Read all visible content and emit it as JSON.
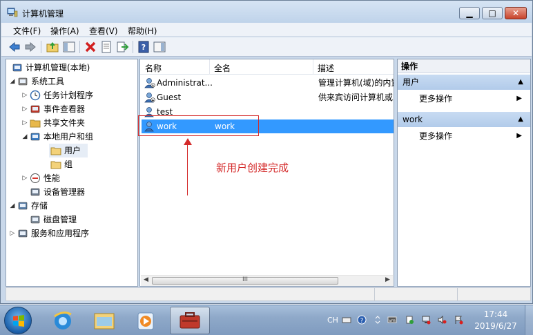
{
  "window": {
    "title": "计算机管理",
    "min_glyph": "▁",
    "max_glyph": "□",
    "close_glyph": "✕"
  },
  "menu": [
    "文件(F)",
    "操作(A)",
    "查看(V)",
    "帮助(H)"
  ],
  "toolbar_icons": [
    "back-arrow-icon",
    "forward-arrow-icon",
    "up-folder-icon",
    "show-hide-tree-icon",
    "delete-icon",
    "properties-icon",
    "export-icon",
    "help-icon",
    "show-hide-action-pane-icon"
  ],
  "tree": [
    {
      "label": "计算机管理(本地)",
      "arrow": "",
      "icon": "computer-management-icon"
    },
    {
      "label": "系统工具",
      "arrow": "◢",
      "icon": "tools-icon"
    },
    {
      "label": "任务计划程序",
      "arrow": "▷",
      "icon": "clock-icon"
    },
    {
      "label": "事件查看器",
      "arrow": "▷",
      "icon": "event-viewer-icon"
    },
    {
      "label": "共享文件夹",
      "arrow": "▷",
      "icon": "shared-folder-icon"
    },
    {
      "label": "本地用户和组",
      "arrow": "◢",
      "icon": "users-groups-icon"
    },
    {
      "label": "用户",
      "arrow": "",
      "icon": "folder-icon"
    },
    {
      "label": "组",
      "arrow": "",
      "icon": "folder-icon"
    },
    {
      "label": "性能",
      "arrow": "▷",
      "icon": "performance-icon"
    },
    {
      "label": "设备管理器",
      "arrow": "",
      "icon": "device-manager-icon"
    },
    {
      "label": "存储",
      "arrow": "◢",
      "icon": "storage-icon"
    },
    {
      "label": "磁盘管理",
      "arrow": "",
      "icon": "disk-management-icon"
    },
    {
      "label": "服务和应用程序",
      "arrow": "▷",
      "icon": "services-icon"
    }
  ],
  "list": {
    "columns": [
      "名称",
      "全名",
      "描述"
    ],
    "rows": [
      {
        "name": "Administrat...",
        "fullname": "",
        "desc": "管理计算机(域)的内置"
      },
      {
        "name": "Guest",
        "fullname": "",
        "desc": "供来宾访问计算机或"
      },
      {
        "name": "test",
        "fullname": "",
        "desc": ""
      },
      {
        "name": "work",
        "fullname": "work",
        "desc": ""
      }
    ],
    "scroll_grip": "III",
    "scroll_left": "◀",
    "scroll_right": "▶"
  },
  "actions": {
    "header": "操作",
    "groups": [
      {
        "title": "用户",
        "item": "更多操作"
      },
      {
        "title": "work",
        "item": "更多操作"
      }
    ],
    "collapse_glyph": "▲",
    "more_glyph": "▶"
  },
  "annotation": {
    "text": "新用户创建完成",
    "color": "#d42a2a"
  },
  "taskbar": {
    "lang": "CH",
    "time": "17:44",
    "date": "2019/6/27",
    "apps": [
      "internet-explorer-icon",
      "file-explorer-icon",
      "media-player-icon",
      "computer-management-taskbar-icon"
    ]
  },
  "colors": {
    "selection": "#3399ff",
    "action_group": "#b2cbea"
  }
}
